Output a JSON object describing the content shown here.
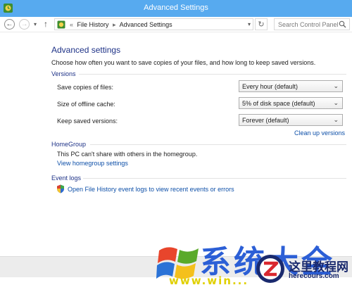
{
  "window": {
    "title": "Advanced Settings",
    "title_bar_color": "#57aaef"
  },
  "navigation": {
    "back_icon": "back-arrow-icon",
    "forward_icon": "forward-arrow-icon",
    "recent_icon": "chevron-down-icon",
    "up_icon": "up-arrow-icon",
    "address_prefix": "«",
    "breadcrumbs": [
      "File History",
      "Advanced Settings"
    ],
    "refresh_icon": "refresh-icon",
    "search_placeholder": "Search Control Panel"
  },
  "main": {
    "heading": "Advanced settings",
    "intro": "Choose how often you want to save copies of your files, and how long to keep saved versions.",
    "versions": {
      "title": "Versions",
      "rows": [
        {
          "label": "Save copies of files:",
          "value": "Every hour (default)"
        },
        {
          "label": "Size of offline cache:",
          "value": "5% of disk space (default)"
        },
        {
          "label": "Keep saved versions:",
          "value": "Forever (default)"
        }
      ],
      "cleanup_link": "Clean up versions"
    },
    "homegroup": {
      "title": "HomeGroup",
      "text": "This PC can't share with others in the homegroup.",
      "link": "View homegroup settings"
    },
    "event_logs": {
      "title": "Event logs",
      "link": "Open File History event logs to view recent events or errors"
    }
  },
  "watermark": {
    "text": "系统大全",
    "url_text": "www.win...",
    "site_name": "这里教程网",
    "site_url": "herecours.com"
  },
  "colors": {
    "heading": "#1e3287",
    "link": "#0d4fa8",
    "watermark_blue": "#2c5fd6"
  }
}
